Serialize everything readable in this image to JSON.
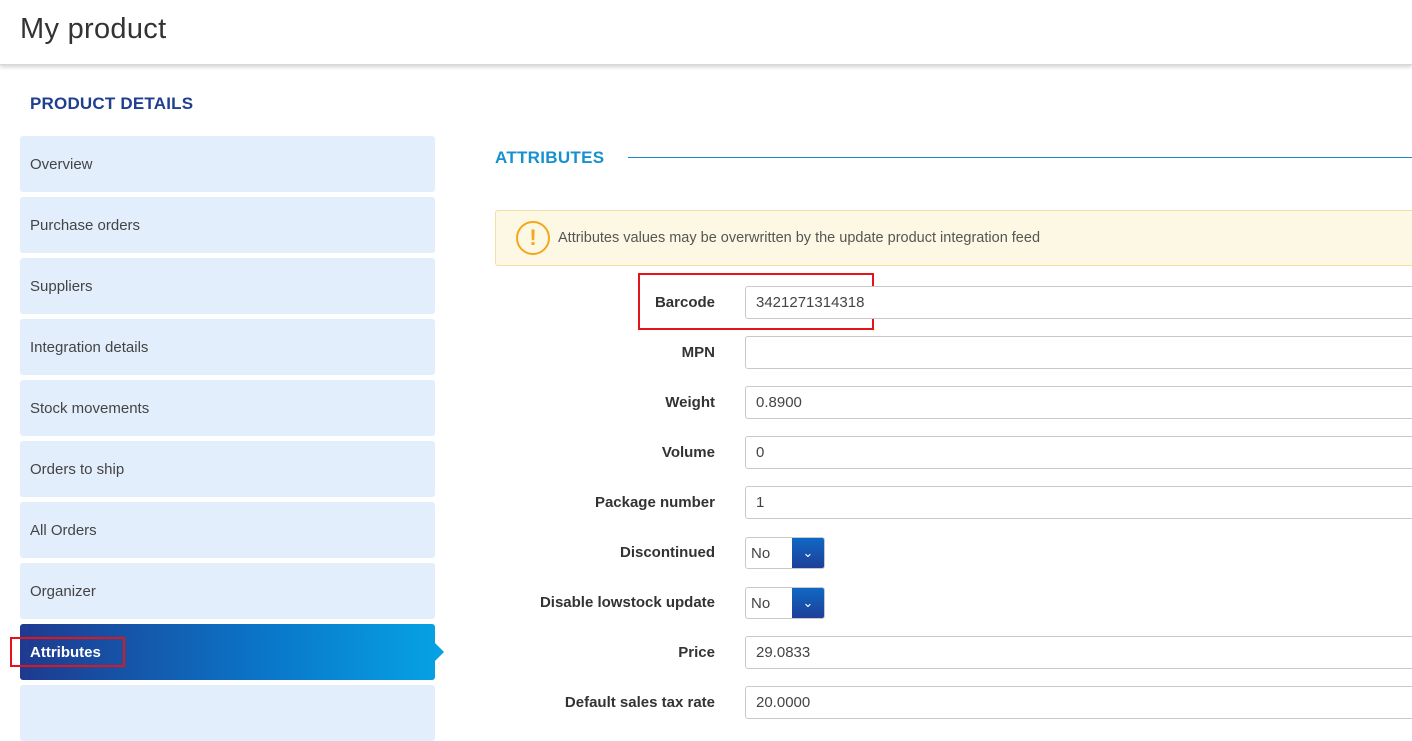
{
  "header": {
    "title": "My product"
  },
  "sidebar": {
    "title": "PRODUCT DETAILS",
    "items": [
      {
        "label": "Overview"
      },
      {
        "label": "Purchase orders"
      },
      {
        "label": "Suppliers"
      },
      {
        "label": "Integration details"
      },
      {
        "label": "Stock movements"
      },
      {
        "label": "Orders to ship"
      },
      {
        "label": "All Orders"
      },
      {
        "label": "Organizer"
      },
      {
        "label": "Attributes",
        "active": true
      }
    ]
  },
  "main": {
    "heading": "ATTRIBUTES",
    "alert": {
      "icon": "warning-icon",
      "text": "Attributes values may be overwritten by the update product integration feed"
    },
    "fields": [
      {
        "label": "Barcode",
        "value": "3421271314318"
      },
      {
        "label": "MPN",
        "value": ""
      },
      {
        "label": "Weight",
        "value": "0.8900"
      },
      {
        "label": "Volume",
        "value": "0"
      },
      {
        "label": "Package number",
        "value": "1"
      },
      {
        "label": "Discontinued",
        "value": "No",
        "type": "select"
      },
      {
        "label": "Disable lowstock update",
        "value": "No",
        "type": "select"
      },
      {
        "label": "Price",
        "value": "29.0833"
      },
      {
        "label": "Default sales tax rate",
        "value": "20.0000"
      }
    ]
  },
  "colors": {
    "accent": "#1f3f8f",
    "heading": "#1790d0",
    "sidebar_bg": "#e3eefc",
    "highlight": "#e4141b",
    "warning": "#f2a81d"
  }
}
